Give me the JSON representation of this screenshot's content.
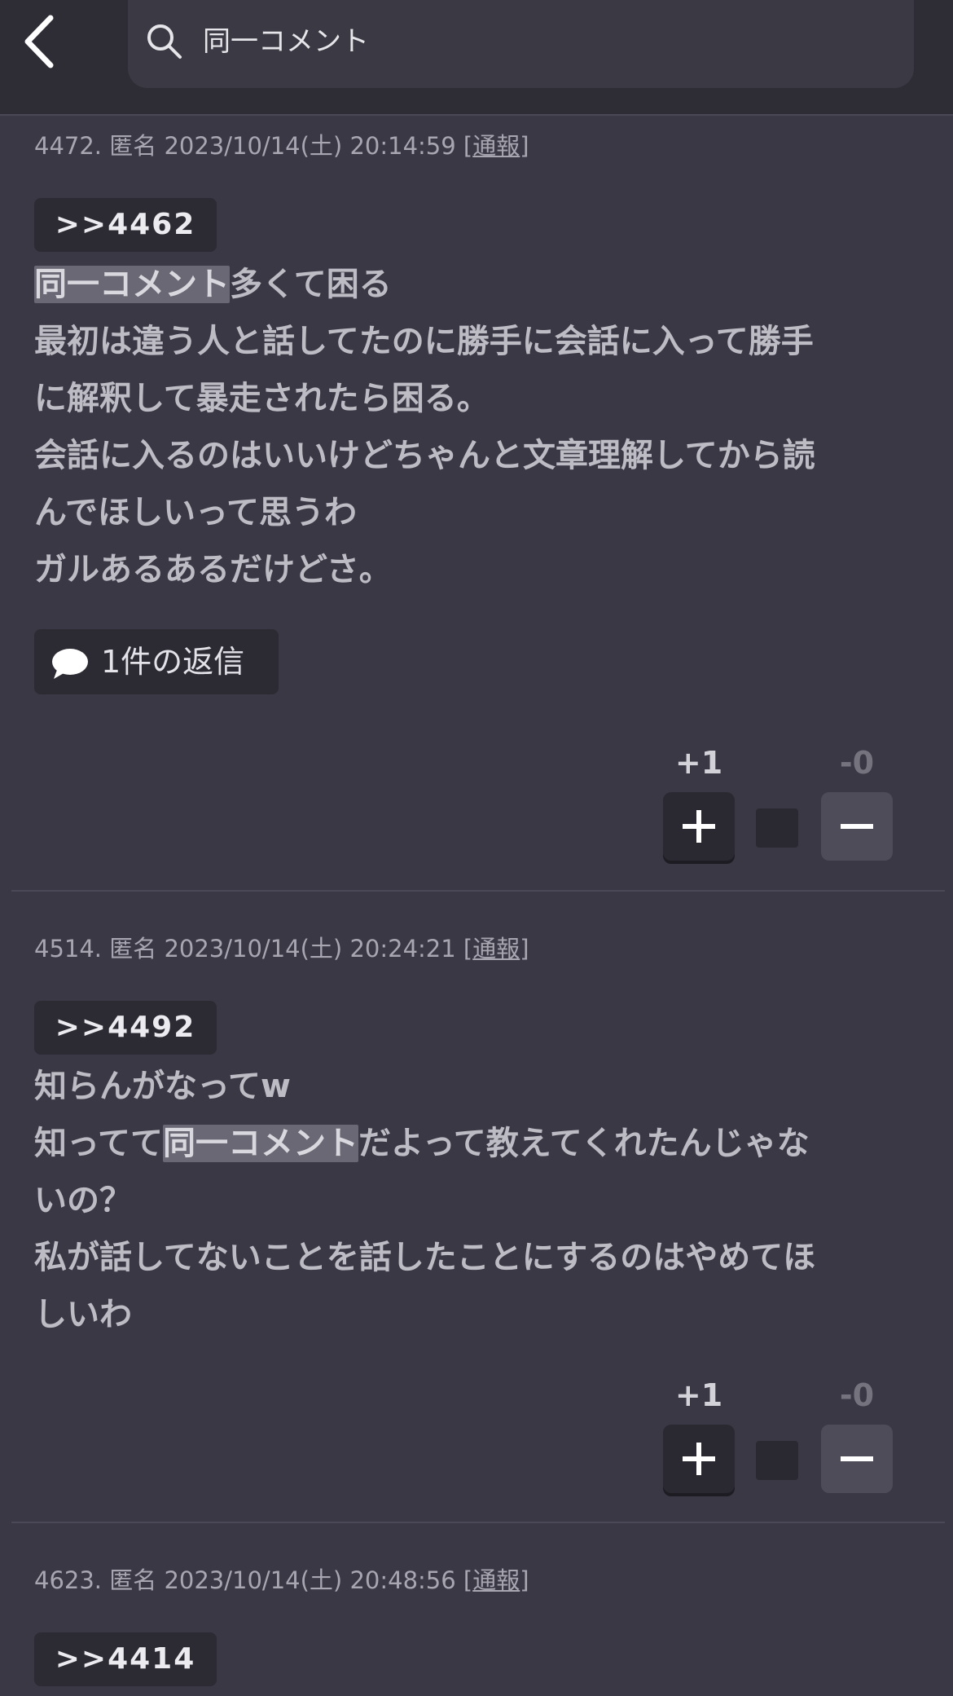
{
  "search": {
    "query": "同一コメント"
  },
  "posts": [
    {
      "meta_prefix": "4472. 匿名 2023/10/14(土) 20:14:59 [",
      "report": "通報",
      "meta_suffix": "]",
      "anchor": ">>4462",
      "lines": [
        [
          "",
          "同一コメント",
          "多くて困る"
        ],
        "最初は違う人と話してたのに勝手に会話に入って勝手",
        "に解釈して暴走されたら困る。",
        "会話に入るのはいいけどちゃんと文章理解してから読",
        "んでほしいって思うわ",
        "ガルあるあるだけどさ。"
      ],
      "reply_label": "1件の返信",
      "plus": "+1",
      "minus": "-0"
    },
    {
      "meta_prefix": "4514. 匿名 2023/10/14(土) 20:24:21 [",
      "report": "通報",
      "meta_suffix": "]",
      "anchor": ">>4492",
      "lines": [
        "知らんがなってw",
        [
          "知ってて",
          "同一コメント",
          "だよって教えてくれたんじゃな"
        ],
        "いの？",
        "私が話してないことを話したことにするのはやめてほ",
        "しいわ"
      ],
      "plus": "+1",
      "minus": "-0"
    },
    {
      "meta_prefix": "4623. 匿名 2023/10/14(土) 20:48:56 [",
      "report": "通報",
      "meta_suffix": "]",
      "anchor": ">>4414"
    }
  ]
}
